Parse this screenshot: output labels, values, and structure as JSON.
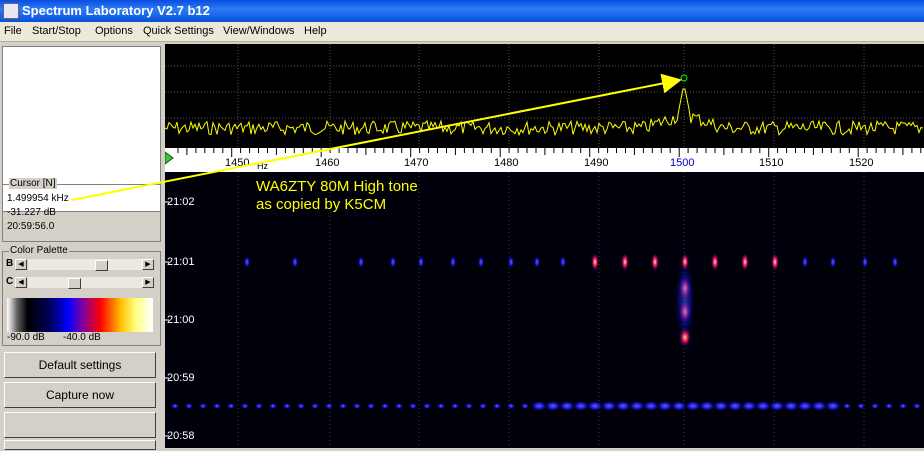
{
  "window": {
    "title": "Spectrum Laboratory V2.7 b12"
  },
  "menu": [
    "File",
    "Start/Stop",
    "Options",
    "Quick Settings",
    "View/Windows",
    "Help"
  ],
  "cursor": {
    "label": "Cursor [N]",
    "frequency": "1.499954 kHz",
    "level": "-31.227 dB",
    "time": "20:59:56.0"
  },
  "palette": {
    "label": "Color Palette",
    "b_label": "B",
    "c_label": "C",
    "min_db": "-90.0 dB",
    "max_db": "-40.0 dB"
  },
  "buttons": {
    "default_settings": "Default settings",
    "capture_now": "Capture now"
  },
  "freq_axis": {
    "unit": "Hz",
    "ticks": [
      "1450",
      "1460",
      "1470",
      "1480",
      "1490",
      "1500",
      "1510",
      "1520"
    ]
  },
  "waterfall": {
    "times": [
      "21:02",
      "21:01",
      "21:00",
      "20:59",
      "20:58"
    ]
  },
  "annotation": {
    "line1": "WA6ZTY 80M High tone",
    "line2": "as copied by K5CM"
  },
  "colors": {
    "trace": "#ffff00",
    "title_bar": "#0a4ce0",
    "marker": "#00ff00"
  }
}
